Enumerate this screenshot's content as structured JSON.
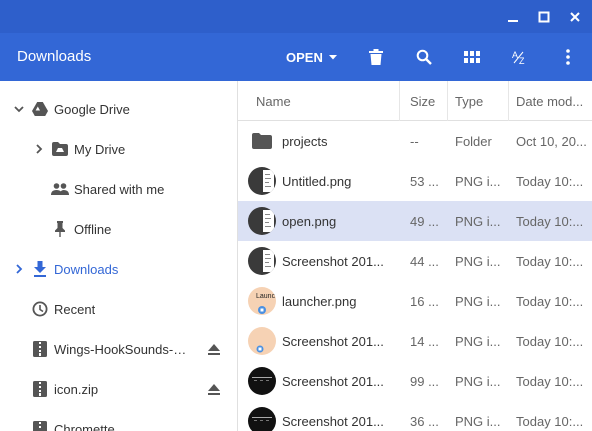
{
  "header": {
    "title": "Downloads",
    "open_label": "OPEN"
  },
  "toolbar_icons": [
    "delete-icon",
    "search-icon",
    "grid-view-icon",
    "sort-az-icon",
    "more-vert-icon"
  ],
  "colors": {
    "titlebar": "#2e5fcb",
    "toolbar": "#3367d6",
    "accent": "#3367d6",
    "selected_row": "#dbe1f4"
  },
  "sidebar": {
    "items": [
      {
        "label": "Google Drive",
        "icon": "google-drive-icon",
        "expanded": true
      },
      {
        "label": "My Drive",
        "icon": "my-drive-icon"
      },
      {
        "label": "Shared with me",
        "icon": "people-icon"
      },
      {
        "label": "Offline",
        "icon": "pin-icon"
      },
      {
        "label": "Downloads",
        "icon": "download-icon",
        "active": true
      },
      {
        "label": "Recent",
        "icon": "clock-icon"
      },
      {
        "label": "Wings-HookSounds-n...",
        "icon": "archive-icon",
        "ejectable": true
      },
      {
        "label": "icon.zip",
        "icon": "archive-icon",
        "ejectable": true
      },
      {
        "label": "Chromette",
        "icon": "archive-icon"
      }
    ]
  },
  "columns": {
    "name": "Name",
    "size": "Size",
    "type": "Type",
    "date": "Date mod..."
  },
  "files": [
    {
      "name": "projects",
      "size": "--",
      "type": "Folder",
      "date": "Oct 10, 20...",
      "kind": "folder"
    },
    {
      "name": "Untitled.png",
      "size": "53 ...",
      "type": "PNG i...",
      "date": "Today 10:...",
      "kind": "doc"
    },
    {
      "name": "open.png",
      "size": "49 ...",
      "type": "PNG i...",
      "date": "Today 10:...",
      "kind": "doc",
      "selected": true
    },
    {
      "name": "Screenshot 201...",
      "size": "44 ...",
      "type": "PNG i...",
      "date": "Today 10:...",
      "kind": "doc"
    },
    {
      "name": "launcher.png",
      "size": "16 ...",
      "type": "PNG i...",
      "date": "Today 10:...",
      "kind": "launcher"
    },
    {
      "name": "Screenshot 201...",
      "size": "14 ...",
      "type": "PNG i...",
      "date": "Today 10:...",
      "kind": "peach"
    },
    {
      "name": "Screenshot 201...",
      "size": "99 ...",
      "type": "PNG i...",
      "date": "Today 10:...",
      "kind": "dark"
    },
    {
      "name": "Screenshot 201...",
      "size": "36 ...",
      "type": "PNG i...",
      "date": "Today 10:...",
      "kind": "dark"
    }
  ],
  "launcher_thumb_text": "Launc Butto"
}
